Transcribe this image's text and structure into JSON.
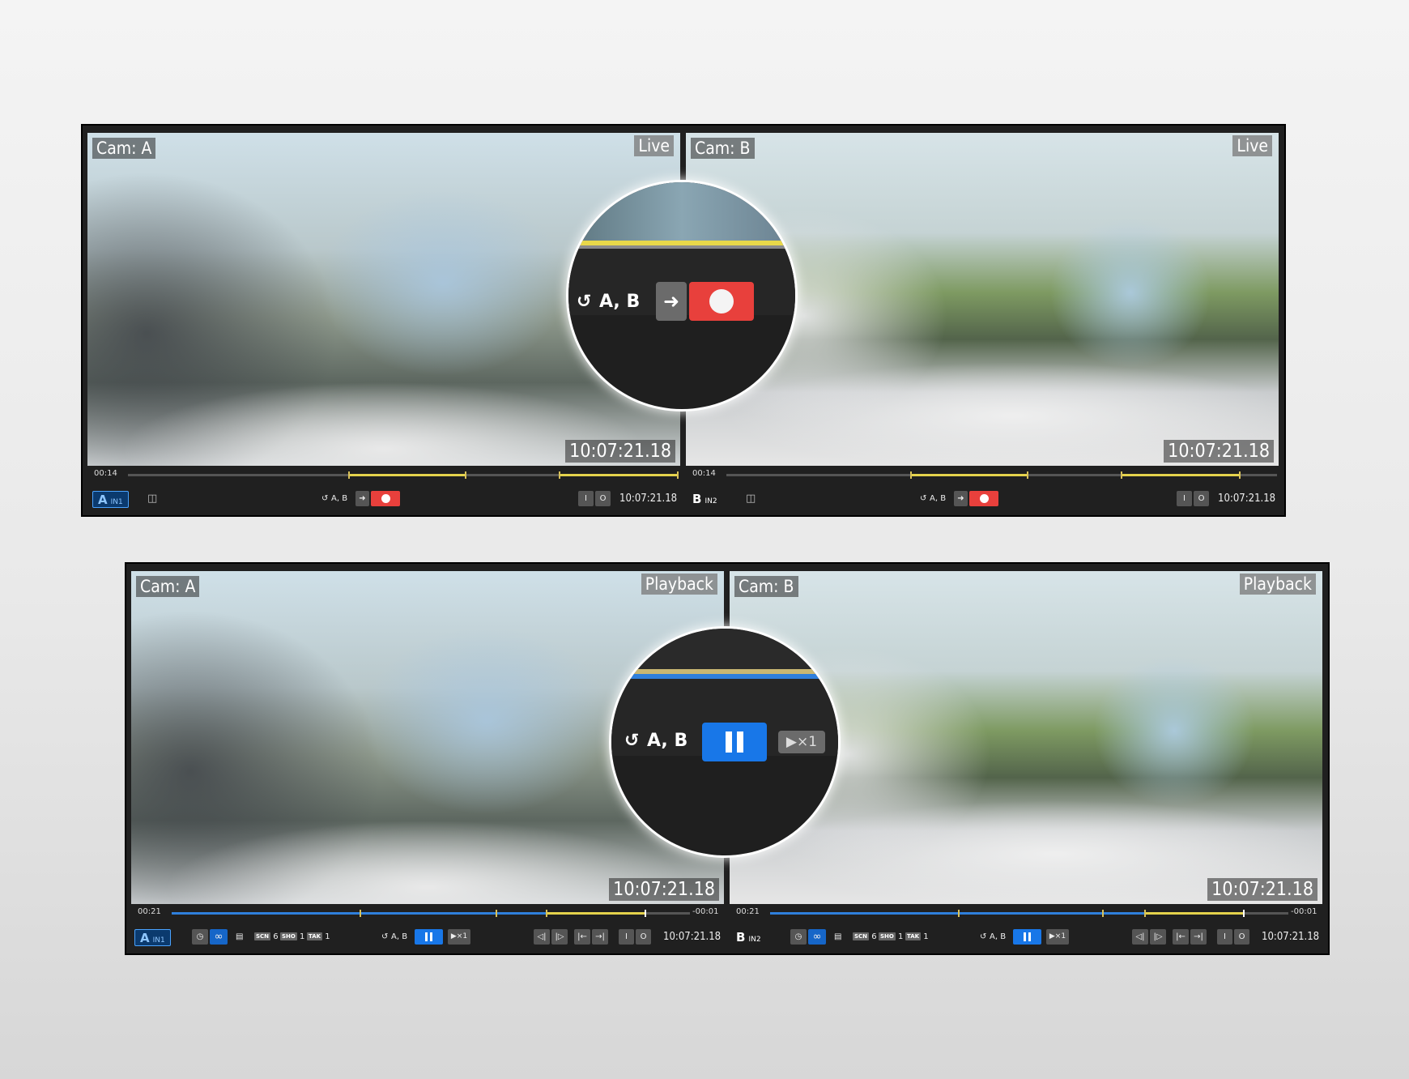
{
  "top": {
    "a": {
      "cam": "Cam: A",
      "mode": "Live",
      "timecode": "10:07:21.18",
      "elapsed": "00:14",
      "badge": "A",
      "input": "IN1",
      "cams": "A, B",
      "in_btn": "I",
      "out_btn": "O",
      "tc_small": "10:07:21.18"
    },
    "b": {
      "cam": "Cam: B",
      "mode": "Live",
      "timecode": "10:07:21.18",
      "elapsed": "00:14",
      "badge": "B",
      "input": "IN2",
      "cams": "A, B",
      "in_btn": "I",
      "out_btn": "O",
      "tc_small": "10:07:21.18"
    },
    "magnifier": {
      "cams": "A, B"
    }
  },
  "bottom": {
    "a": {
      "cam": "Cam: A",
      "mode": "Playback",
      "timecode": "10:07:21.18",
      "elapsed": "00:21",
      "remaining": "-00:01",
      "badge": "A",
      "input": "IN1",
      "scn_label": "SCN",
      "scn": "6",
      "sho_label": "SHO",
      "sho": "1",
      "tak_label": "TAK",
      "tak": "1",
      "cams": "A, B",
      "speed": "▶×1",
      "in_btn": "I",
      "out_btn": "O",
      "tc_small": "10:07:21.18"
    },
    "b": {
      "cam": "Cam: B",
      "mode": "Playback",
      "timecode": "10:07:21.18",
      "elapsed": "00:21",
      "remaining": "-00:01",
      "badge": "B",
      "input": "IN2",
      "scn_label": "SCN",
      "scn": "6",
      "sho_label": "SHO",
      "sho": "1",
      "tak_label": "TAK",
      "tak": "1",
      "cams": "A, B",
      "speed": "▶×1",
      "in_btn": "I",
      "out_btn": "O",
      "tc_small": "10:07:21.18"
    },
    "magnifier": {
      "cams": "A, B",
      "speed": "▶×1"
    }
  },
  "colors": {
    "record": "#e8403c",
    "accent": "#1877e8",
    "clip_marker": "#e4d24c"
  },
  "icons": [
    "camera-icon",
    "recent-cams-icon",
    "arrow-right-icon",
    "record-icon",
    "pause-icon",
    "play-speed-icon",
    "clock-icon",
    "loop-icon",
    "film-icon",
    "step-back-icon",
    "step-forward-icon",
    "go-start-icon",
    "go-end-icon"
  ]
}
